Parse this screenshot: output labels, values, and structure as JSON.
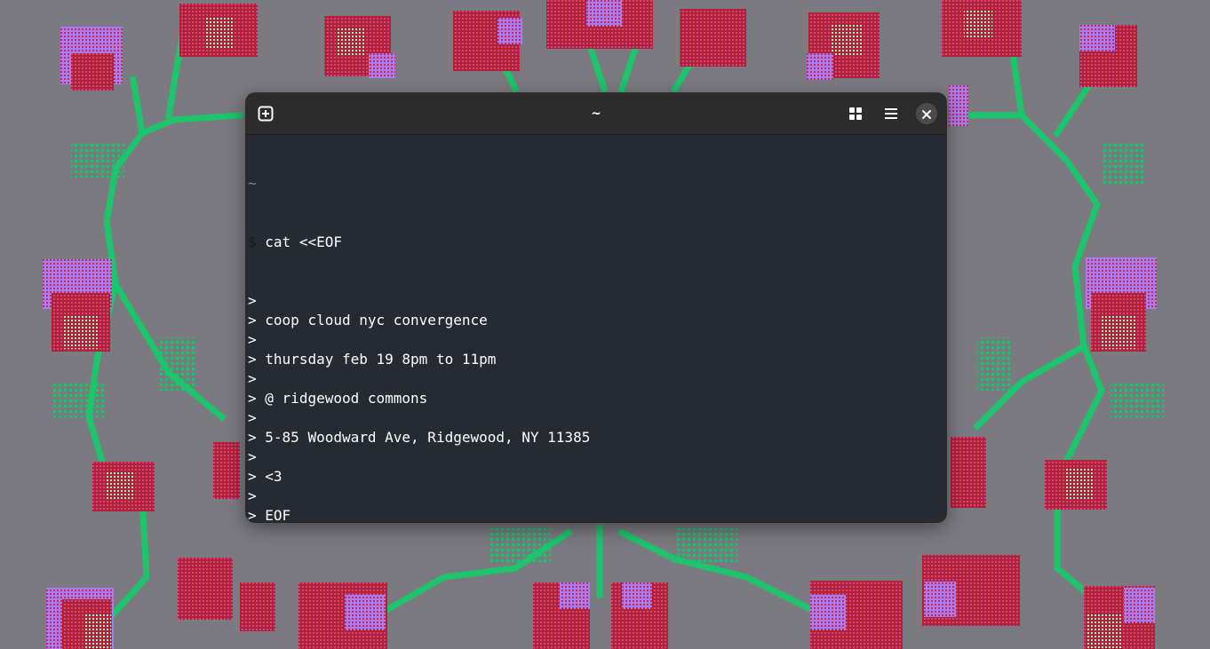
{
  "colors": {
    "desktop_bg": "#7b7a80",
    "leaf_green": "#1cc46c",
    "petal_red": "#b22234",
    "petal_purple": "#a87cf0",
    "petal_mint": "#8cf0d6",
    "terminal_bg": "#262a32",
    "headerbar_bg": "#2c2c2c"
  },
  "window": {
    "title": "~",
    "icons": {
      "new_tab": "new-tab-icon",
      "tab_overview": "tab-overview-icon",
      "menu": "menu-icon",
      "close": "close-icon"
    }
  },
  "terminal": {
    "cwd": "~",
    "prompt_symbol": "$",
    "command": "cat <<EOF",
    "continuation_symbol": ">",
    "lines": [
      "",
      "coop cloud nyc convergence",
      "",
      "thursday feb 19 8pm to 11pm",
      "",
      "@ ridgewood commons",
      "",
      "5-85 Woodward Ave, Ridgewood, NY 11385",
      "",
      "<3",
      "",
      "EOF"
    ]
  }
}
